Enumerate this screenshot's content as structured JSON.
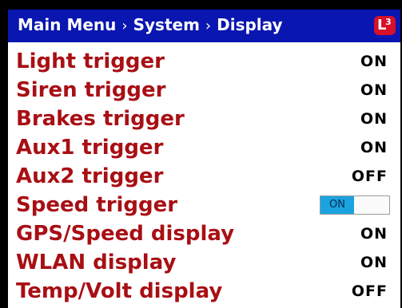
{
  "header": {
    "breadcrumb": [
      "Main Menu",
      "System",
      "Display"
    ],
    "separator": "›",
    "logo": {
      "letter": "L",
      "number": "3"
    }
  },
  "settings": [
    {
      "label": "Light trigger",
      "value": "ON"
    },
    {
      "label": "Siren trigger",
      "value": "ON"
    },
    {
      "label": "Brakes trigger",
      "value": "ON"
    },
    {
      "label": "Aux1 trigger",
      "value": "ON"
    },
    {
      "label": "Aux2 trigger",
      "value": "OFF"
    },
    {
      "label": "Speed trigger",
      "value": "ON"
    },
    {
      "label": "GPS/Speed display",
      "value": "ON"
    },
    {
      "label": "WLAN display",
      "value": "ON"
    },
    {
      "label": "Temp/Volt display",
      "value": "OFF"
    }
  ],
  "colors": {
    "header_bg": "#0a16b0",
    "label": "#a80f14",
    "toggle_on": "#1aa3df",
    "logo_bg": "#d8102a"
  }
}
